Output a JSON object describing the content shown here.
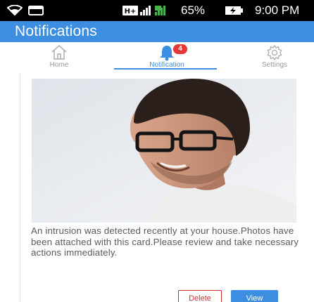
{
  "status_bar": {
    "battery_percent": "65%",
    "time": "9:00 PM",
    "icons": [
      "wifi-icon",
      "sd-card-icon",
      "hplus-network-icon",
      "signal-bars-icon",
      "battery-charging-icon"
    ]
  },
  "app_bar": {
    "title": "Notifications",
    "color": "#3d8ee0"
  },
  "tabs": [
    {
      "label": "Home",
      "icon": "home-icon",
      "active": false
    },
    {
      "label": "Notification",
      "icon": "bell-icon",
      "active": true,
      "badge": "4"
    },
    {
      "label": "Settings",
      "icon": "gear-icon",
      "active": false
    }
  ],
  "card": {
    "image": "intrusion-photo",
    "message": "An intrusion was detected recently at your house.Photos have been attached with this card.Please review and take necessary actions immediately.",
    "actions": {
      "delete_label": "Delete",
      "view_label": "View"
    }
  },
  "colors": {
    "accent": "#3d8ee0",
    "danger": "#d32f2f",
    "badge": "#e53935"
  }
}
